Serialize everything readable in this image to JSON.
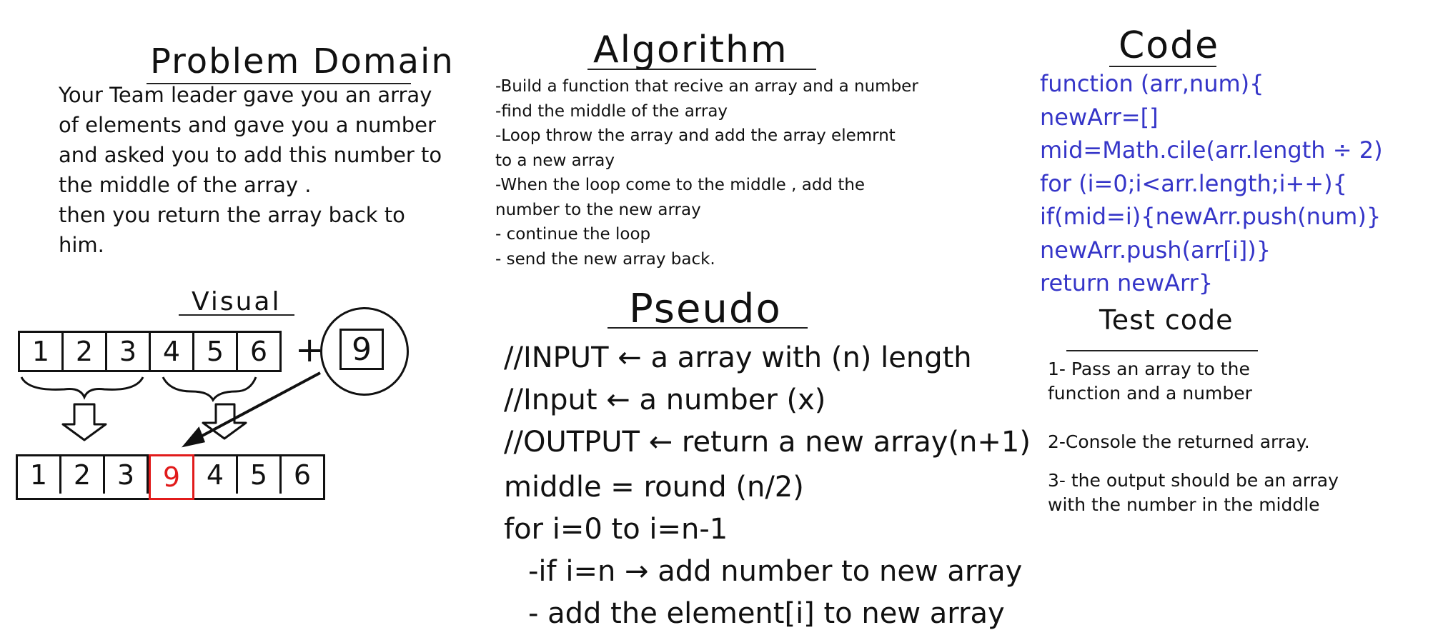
{
  "problem": {
    "heading": "Problem Domain",
    "lines": [
      "Your Team leader gave you an array",
      "of elements and gave you a number",
      "and asked you to add this number to",
      "the middle of the array .",
      "then you return the array back to",
      "him."
    ]
  },
  "visual": {
    "heading": "Visual",
    "input_array": [
      "1",
      "2",
      "3",
      "4",
      "5",
      "6"
    ],
    "plus": "+",
    "number": "9",
    "output_array": [
      "1",
      "2",
      "3",
      "9",
      "4",
      "5",
      "6"
    ],
    "highlight_color": "#e11b1b"
  },
  "algorithm": {
    "heading": "Algorithm",
    "lines": [
      "-Build a function that recive an array and a number",
      "-find the middle of the array",
      "-Loop throw the array and add the array elemrnt",
      "to a new array",
      "-When the loop come to the middle , add the",
      "number to the new array",
      "- continue the loop",
      "- send the new array back."
    ]
  },
  "pseudo": {
    "heading": "Pseudo",
    "lines": [
      "//INPUT ← a array with (n) length",
      "//Input ←  a number (x)",
      "//OUTPUT ← return a new array(n+1)",
      "middle = round (n/2)",
      "for i=0 to i=n-1",
      "   -if i=n → add number to new array",
      "   - add the element[i] to new array"
    ]
  },
  "code": {
    "heading": "Code",
    "text_color": "#3535c8",
    "lines": [
      "function (arr,num){",
      "newArr=[]",
      "mid=Math.cile(arr.length ÷ 2)",
      "for (i=0;i<arr.length;i++){",
      "if(mid=i){newArr.push(num)}",
      "newArr.push(arr[i])}",
      "return newArr}"
    ]
  },
  "test": {
    "heading": "Test code",
    "items": [
      "1- Pass an array to the function and a number",
      "2-Console the returned array.",
      "3- the output should be an array with the number in the middle"
    ]
  }
}
